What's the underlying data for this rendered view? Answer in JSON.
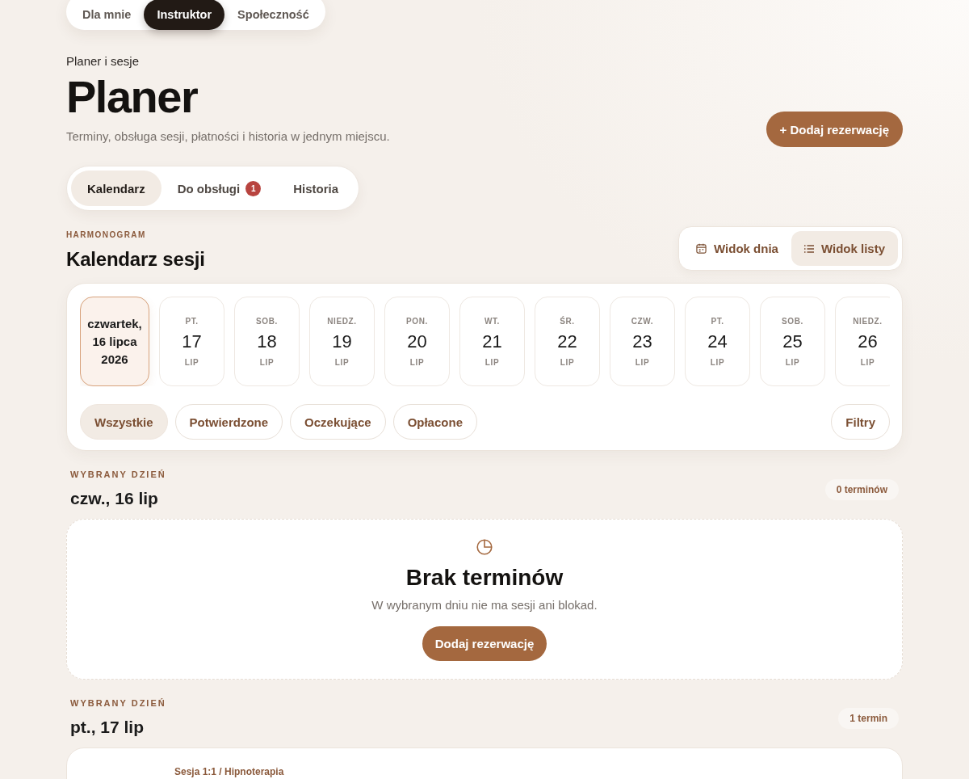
{
  "top_tabs": [
    {
      "label": "Dla mnie",
      "selected": false
    },
    {
      "label": "Instruktor",
      "selected": true
    },
    {
      "label": "Społeczność",
      "selected": false
    }
  ],
  "header": {
    "eyebrow": "Planer i sesje",
    "title": "Planer",
    "subtitle": "Terminy, obsługa sesji, płatności i historia w jednym miejscu.",
    "add_button": "+ Dodaj rezerwację"
  },
  "section_tabs": [
    {
      "label": "Kalendarz",
      "selected": true
    },
    {
      "label": "Do obsługi",
      "selected": false,
      "badge": "1"
    },
    {
      "label": "Historia",
      "selected": false
    }
  ],
  "schedule": {
    "eyebrow": "HARMONOGRAM",
    "title": "Kalendarz sesji",
    "views": [
      {
        "kind": "day",
        "label": "Widok dnia",
        "selected": false
      },
      {
        "kind": "list",
        "label": "Widok listy",
        "selected": true
      }
    ]
  },
  "calendar": {
    "days": [
      {
        "kind": "full",
        "label": "czwartek, 16 lipca 2026",
        "selected": true
      },
      {
        "kind": "compact",
        "weekday": "PT.",
        "day": "17",
        "month": "LIP",
        "selected": false
      },
      {
        "kind": "compact",
        "weekday": "SOB.",
        "day": "18",
        "month": "LIP",
        "selected": false
      },
      {
        "kind": "compact",
        "weekday": "NIEDZ.",
        "day": "19",
        "month": "LIP",
        "selected": false
      },
      {
        "kind": "compact",
        "weekday": "PON.",
        "day": "20",
        "month": "LIP",
        "selected": false
      },
      {
        "kind": "compact",
        "weekday": "WT.",
        "day": "21",
        "month": "LIP",
        "selected": false
      },
      {
        "kind": "compact",
        "weekday": "ŚR.",
        "day": "22",
        "month": "LIP",
        "selected": false
      },
      {
        "kind": "compact",
        "weekday": "CZW.",
        "day": "23",
        "month": "LIP",
        "selected": false
      },
      {
        "kind": "compact",
        "weekday": "PT.",
        "day": "24",
        "month": "LIP",
        "selected": false
      },
      {
        "kind": "compact",
        "weekday": "SOB.",
        "day": "25",
        "month": "LIP",
        "selected": false
      },
      {
        "kind": "compact",
        "weekday": "NIEDZ.",
        "day": "26",
        "month": "LIP",
        "selected": false
      }
    ],
    "filters": [
      {
        "label": "Wszystkie",
        "selected": true
      },
      {
        "label": "Potwierdzone",
        "selected": false
      },
      {
        "label": "Oczekujące",
        "selected": false
      },
      {
        "label": "Opłacone",
        "selected": false
      }
    ],
    "filters_button": "Filtry"
  },
  "day_sections": [
    {
      "eyebrow": "WYBRANY DZIEŃ",
      "title": "czw., 16 lip",
      "count": "0 terminów",
      "empty": {
        "title": "Brak terminów",
        "text": "W wybranym dniu nie ma sesji ani blokad.",
        "button": "Dodaj rezerwację"
      }
    },
    {
      "eyebrow": "WYBRANY DZIEŃ",
      "title": "pt., 17 lip",
      "count": "1 termin",
      "sessions": [
        {
          "type": "Sesja 1:1 / Hipnoterapia"
        }
      ]
    }
  ]
}
